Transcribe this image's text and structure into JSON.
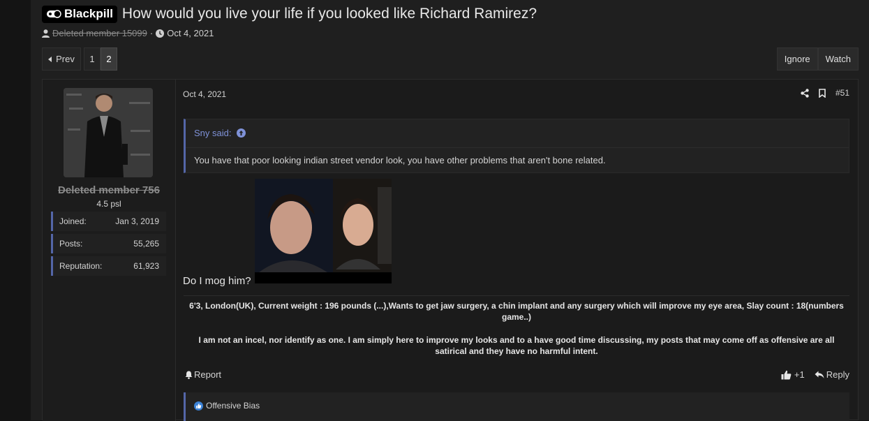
{
  "thread": {
    "prefix": "Blackpill",
    "title": "How would you live your life if you looked like Richard Ramirez?",
    "author": "Deleted member 15099",
    "date": "Oct 4, 2021"
  },
  "pagination": {
    "prev_label": "Prev",
    "pages": [
      "1",
      "2"
    ],
    "current": "2"
  },
  "thread_actions": {
    "ignore_label": "Ignore",
    "watch_label": "Watch"
  },
  "user": {
    "name": "Deleted member 756",
    "title": "4.5 psl",
    "stats": [
      {
        "label": "Joined:",
        "value": "Jan 3, 2019"
      },
      {
        "label": "Posts:",
        "value": "55,265"
      },
      {
        "label": "Reputation:",
        "value": "61,923"
      }
    ]
  },
  "post": {
    "date": "Oct 4, 2021",
    "number": "#51",
    "quote_author": "Sny said:",
    "quote_text": "You have that poor looking indian street vendor look, you have other problems that aren't bone related.",
    "body_text": "Do I mog him?",
    "signature_line1": "6'3, London(UK), Current weight : 196 pounds (...),Wants to get jaw surgery, a chin implant and any surgery which will improve my eye area, Slay count : 18(numbers game..)",
    "signature_line2": "I am not an incel, nor identify as one. I am simply here to improve my looks and to a have good time discussing, my posts that may come off as offensive are all satirical and they have no harmful intent.",
    "report_label": "Report",
    "like_count": "+1",
    "reply_label": "Reply",
    "reaction_label": "Offensive Bias"
  },
  "colors": {
    "accent": "#5466a8",
    "quote_link": "#7f92d8",
    "background": "#1f1f1f"
  }
}
